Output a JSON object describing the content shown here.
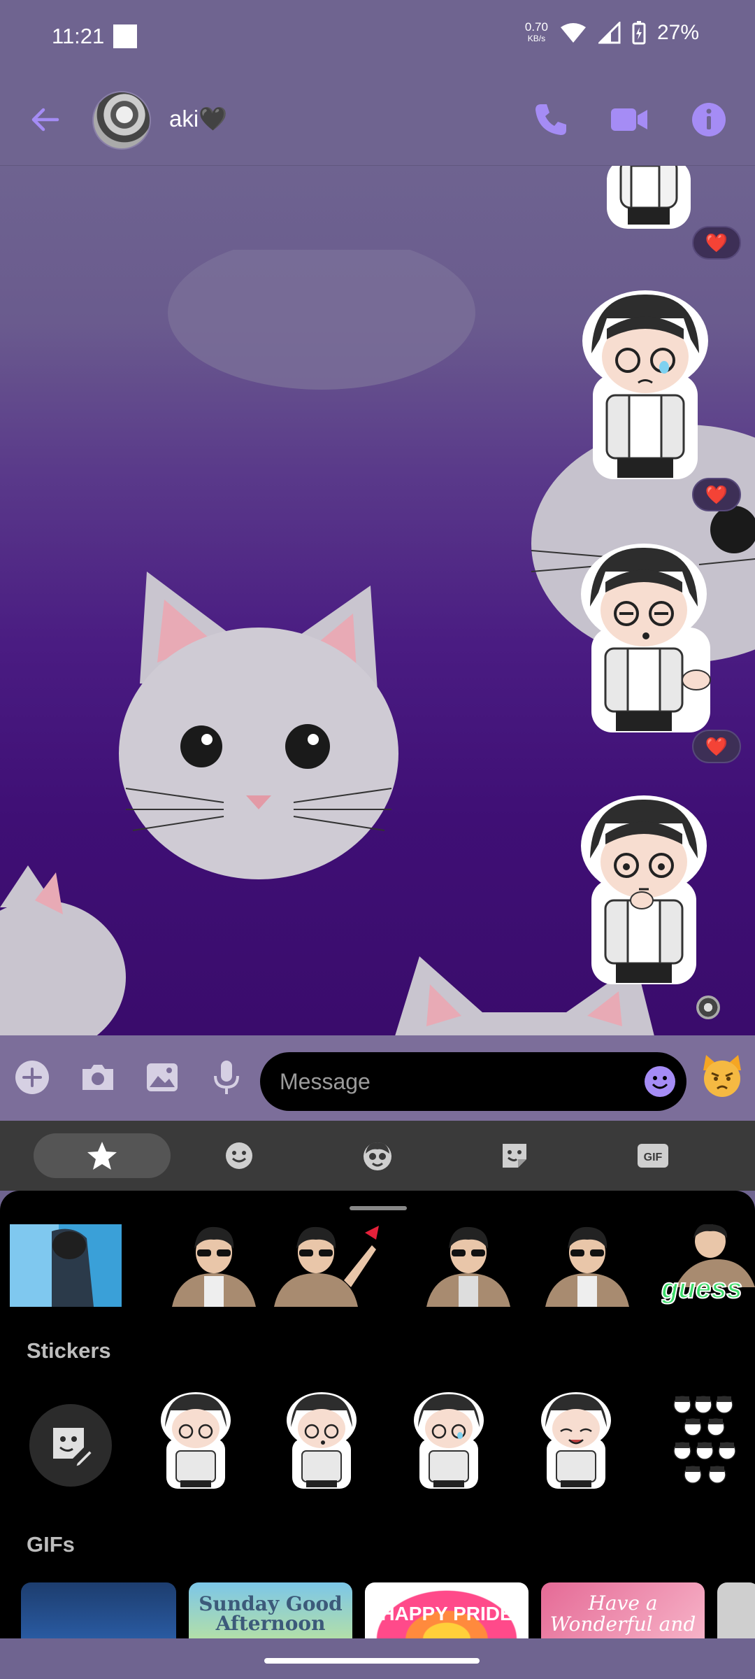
{
  "status_bar": {
    "time": "11:21",
    "net_speed_value": "0.70",
    "net_speed_unit": "KB/s",
    "battery_text": "27%"
  },
  "header": {
    "contact_name": "aki🖤",
    "icons": [
      "back-arrow-icon",
      "phone-icon",
      "video-camera-icon",
      "info-icon"
    ],
    "accent_color": "#a58cf5"
  },
  "composer": {
    "placeholder": "Message",
    "icons": [
      "plus-icon",
      "camera-icon",
      "gallery-icon",
      "microphone-icon",
      "emoji-icon",
      "cat-emoji-icon"
    ]
  },
  "picker_tabs": [
    "favorites-star-icon",
    "emoji-icon",
    "avatar-sticker-icon",
    "sticker-icon",
    "gif-icon"
  ],
  "picker": {
    "stickers_label": "Stickers",
    "gifs_label": "GIFs",
    "recent_thumb_text": "guess",
    "gifs": [
      {
        "text": ""
      },
      {
        "text": "Sunday Good Afternoon"
      },
      {
        "text": "HAPPY PRIDE"
      },
      {
        "text": "Have a Wonderful and"
      }
    ]
  },
  "reactions": [
    "❤️",
    "❤️",
    "❤️"
  ]
}
